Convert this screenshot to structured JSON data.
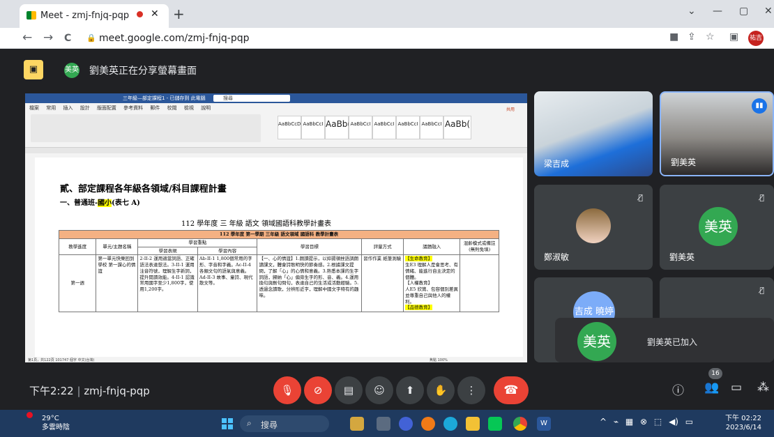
{
  "browser": {
    "tab_title": "Meet - zmj-fnjq-pqp",
    "new_tab": "+",
    "url": "meet.google.com/zmj-fnjq-pqp",
    "back": "←",
    "forward": "→",
    "reload": "C",
    "min": "—",
    "max": "▢",
    "close": "✕",
    "tabs_menu": "⌄",
    "avatar": "祐吉"
  },
  "banner": {
    "badge": "美英",
    "text": "劉美英正在分享螢幕畫面"
  },
  "shared_doc": {
    "window_title": "三年級—部定課程1 - 已儲存到 此電腦",
    "search": "搜尋",
    "ribbon_tabs": [
      "檔案",
      "常用",
      "插入",
      "設計",
      "版面配置",
      "參考資料",
      "郵件",
      "校閱",
      "檢視",
      "說明"
    ],
    "share": "共用",
    "styles": [
      "AaBbCcD",
      "AaBbCcI",
      "AaBb(",
      "AaBbCcI",
      "AaBbCcI",
      "AaBbCcI",
      "AaBbCcI",
      "AaBb("
    ],
    "heading1": "貳、部定課程各年級各領域/科目課程計畫",
    "heading2_a": "一、普通班-",
    "heading2_hl": "國小",
    "heading2_b": "(表七 A)",
    "caption": "112 學年度    三   年級    語文   領域國語科教學計畫表",
    "table": {
      "band": "112 學年度  第一學期  三年級  語文領域  國語科  教學計畫表",
      "col_progress": "教學進度",
      "col_unit": "單元/主題名稱",
      "col_focus": "學習重點",
      "col_perf": "學習表現",
      "col_content": "學習內容",
      "col_goal": "學習目標",
      "col_eval": "評量方式",
      "col_issue": "議題融入",
      "col_mixed": "混齡模式或備註(無則免填)",
      "week": "第一週",
      "unit": "第一單元快樂回到學校 第一課心的情誼",
      "perf": "2-II-2 運用適當詞語、正確語法表達想法。3-II-1 運用注音符號，理解生字新詞，提升閱讀效能。4-II-1 認識常用國字至少1,800字，使用1,200字。",
      "content": "Ab-II-1 1,800個常用的字形、字音和字義。Ac-II-4 各類文句的語氣與意義。Ad-II-3 故事、童詩、現代散文等。",
      "goal": "【一、心的情誼】1.朗讀提示，以抑揚頓挫語調朗讀課文，體會詩歌明快的節奏感。2.根據課文提問，了解「心」的心情和意義。3.熟悉本課的生字詞語，歸納「心」偏旁生字的形、音、義。4.運用換句與刪句問句，表達自己的生活或活動經驗。5.透過念讀歌，分辨形近字，理解中國文字特有的趣味。",
      "eval": "習作作業 紙筆測驗",
      "issue_tag1": "【生命教育】",
      "issue_body1": "生E3 理解人是會思考、有情緒、能進行自主決定的個體。",
      "issue_tag2": "【人權教育】",
      "issue_body2": "人E5 欣賞、包容個別差異並尊重自己與他人的權利。",
      "issue_tag3": "【品德教育】"
    },
    "status_left": "第1頁，共122頁   101747 個字   中文(台灣)",
    "status_right": "焦點    100%"
  },
  "participants": [
    {
      "name": "梁吉成",
      "muted": false
    },
    {
      "name": "劉美英",
      "muted": false,
      "speaking": true
    },
    {
      "name": "鄭淑敏",
      "muted": true
    },
    {
      "name": "劉美英",
      "muted": true,
      "initials": "美英"
    },
    {
      "name": "",
      "muted": true,
      "initials": "吉成 曉婷"
    }
  ],
  "toast": {
    "initials": "美英",
    "text": "劉美英已加入"
  },
  "controls": {
    "clock": "下午2:22",
    "separator": "|",
    "meeting_code": "zmj-fnjq-pqp",
    "participant_count": "16"
  },
  "taskbar": {
    "temp": "29°C",
    "weather": "多雲時陰",
    "weather_badge": "1",
    "search": "搜尋",
    "time": "下午 02:22",
    "date": "2023/6/14"
  },
  "colors": {
    "accent": "#1a73e8",
    "danger": "#ea4335",
    "bg": "#202124",
    "tile": "#3c4043",
    "highlight": "#ffff00"
  }
}
